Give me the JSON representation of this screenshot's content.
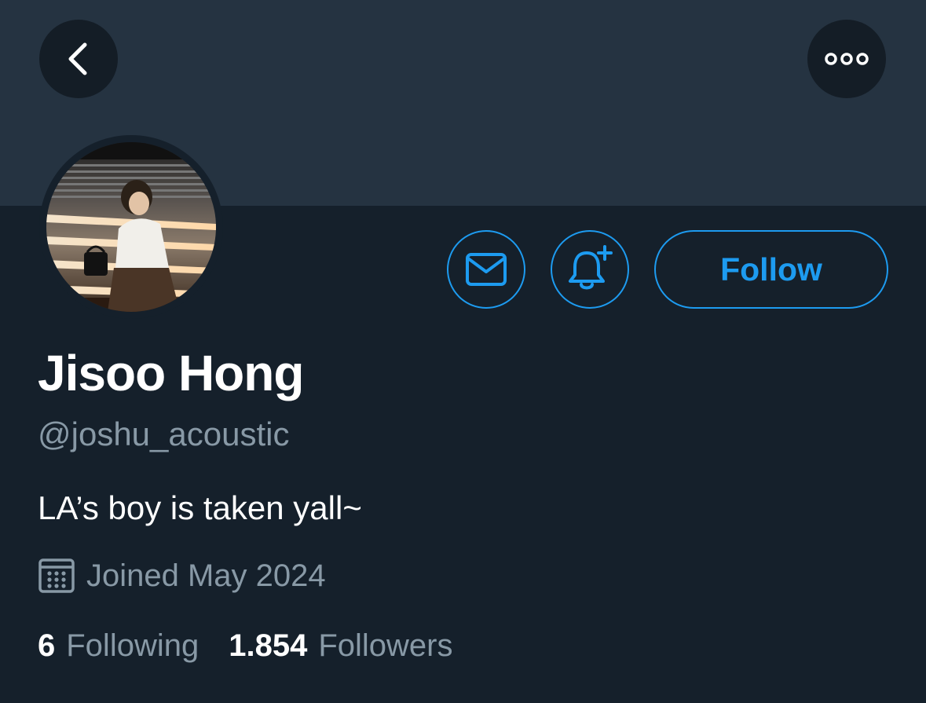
{
  "header": {
    "back_icon": "chevron-left-icon",
    "more_icon": "more-horizontal-icon"
  },
  "profile": {
    "name": "Jisoo Hong",
    "handle": "@joshu_acoustic",
    "bio": "LA’s boy is taken yall~",
    "joined": "Joined May 2024",
    "following_count": "6",
    "following_label": "Following",
    "followers_count": "1.854",
    "followers_label": "Followers"
  },
  "actions": {
    "message_icon": "envelope-icon",
    "notify_icon": "bell-plus-icon",
    "follow_label": "Follow"
  },
  "colors": {
    "background": "#15202b",
    "banner": "#253341",
    "accent": "#1d9bf0",
    "secondary_text": "#8899a6"
  }
}
